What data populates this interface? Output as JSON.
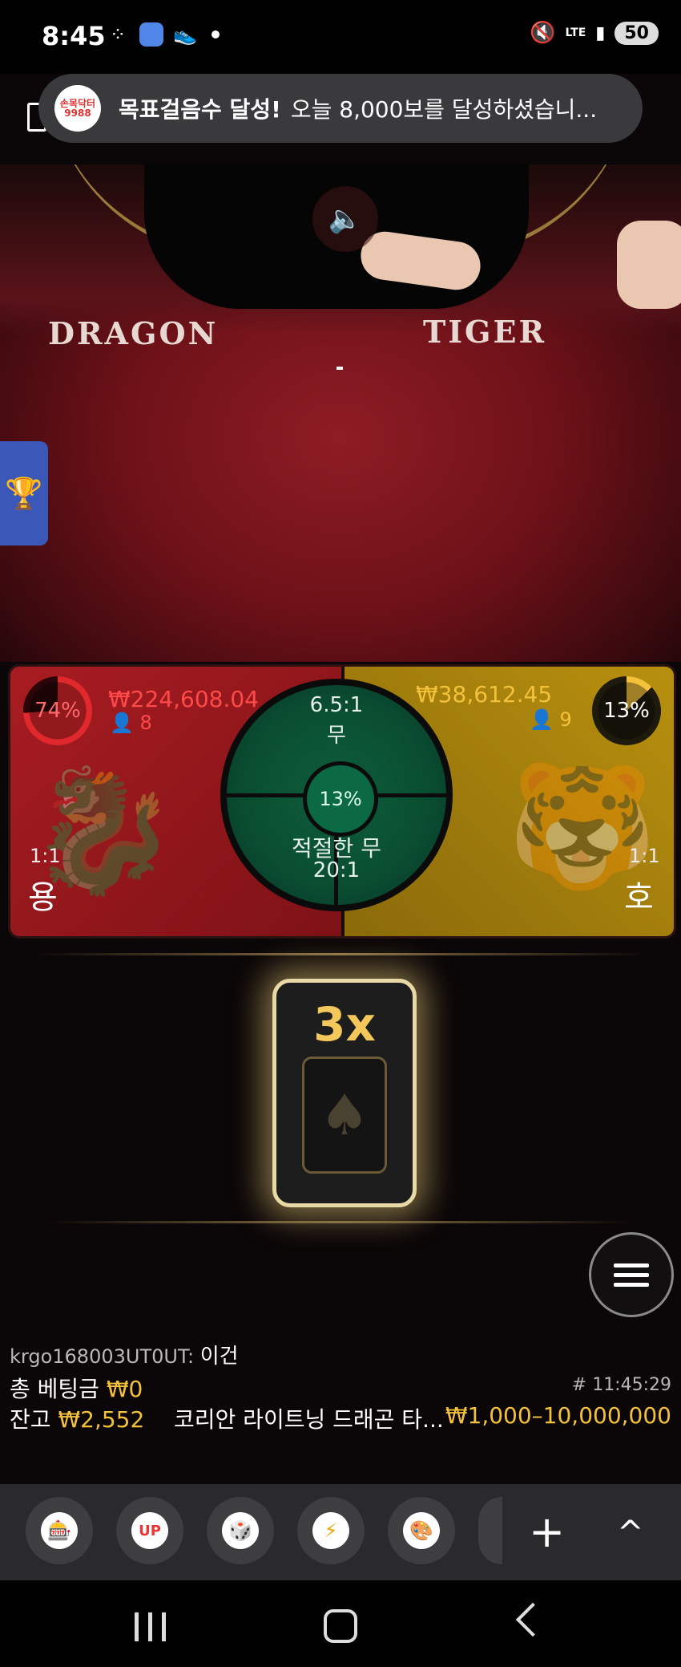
{
  "status_bar": {
    "time": "8:45",
    "network": "LTE",
    "battery": "50"
  },
  "notification": {
    "app_logo_text": "손목닥터 9988",
    "title": "목표걸음수 달성!",
    "body": "오늘 8,000보를 달성하셨습니..."
  },
  "table": {
    "dragon_label": "DRAGON",
    "tiger_label": "TIGER"
  },
  "betting": {
    "dragon": {
      "percent": "74%",
      "percent_value": 74,
      "amount": "₩224,608.04",
      "players": "8",
      "ratio": "1:1",
      "label": "용",
      "color": "#e0282d"
    },
    "tiger": {
      "percent": "13%",
      "percent_value": 13,
      "amount": "₩38,612.45",
      "players": "9",
      "ratio": "1:1",
      "label": "호",
      "color": "#f3c13a"
    },
    "tie": {
      "ratio": "6.5:1",
      "label": "무",
      "percent": "13%",
      "suited_label": "적절한 무",
      "suited_ratio": "20:1"
    }
  },
  "card": {
    "multiplier": "3x",
    "suit": "♠"
  },
  "chat": {
    "user": "krgo168003UT0UT:",
    "message": "이건"
  },
  "info": {
    "total_bet_label": "총 베팅금",
    "total_bet_value": "₩0",
    "round_id": "# 11:45:29",
    "balance_label": "잔고",
    "balance_value": "₩2,552",
    "table_name": "코리안 라이트닝 드래곤 타...",
    "bet_limits": "₩1,000–10,000,000"
  },
  "chip_bar": {
    "plus": "+",
    "up": "^"
  }
}
